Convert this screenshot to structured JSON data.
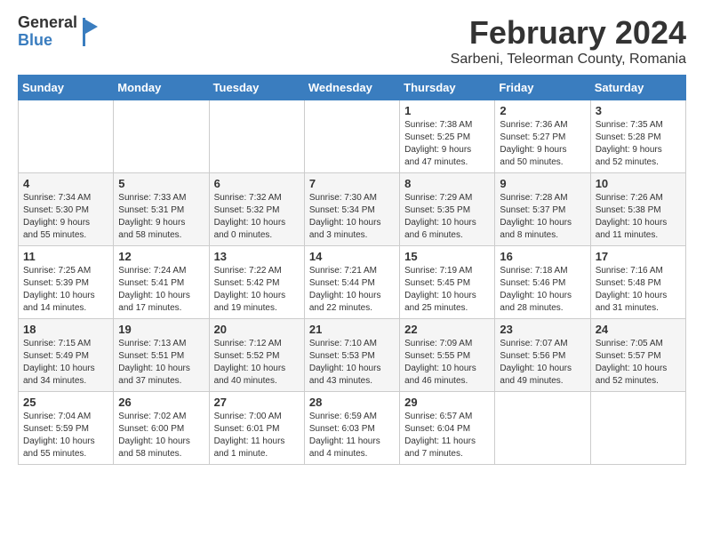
{
  "header": {
    "logo_general": "General",
    "logo_blue": "Blue",
    "month_title": "February 2024",
    "subtitle": "Sarbeni, Teleorman County, Romania"
  },
  "weekdays": [
    "Sunday",
    "Monday",
    "Tuesday",
    "Wednesday",
    "Thursday",
    "Friday",
    "Saturday"
  ],
  "weeks": [
    [
      {
        "day": "",
        "info": ""
      },
      {
        "day": "",
        "info": ""
      },
      {
        "day": "",
        "info": ""
      },
      {
        "day": "",
        "info": ""
      },
      {
        "day": "1",
        "info": "Sunrise: 7:38 AM\nSunset: 5:25 PM\nDaylight: 9 hours\nand 47 minutes."
      },
      {
        "day": "2",
        "info": "Sunrise: 7:36 AM\nSunset: 5:27 PM\nDaylight: 9 hours\nand 50 minutes."
      },
      {
        "day": "3",
        "info": "Sunrise: 7:35 AM\nSunset: 5:28 PM\nDaylight: 9 hours\nand 52 minutes."
      }
    ],
    [
      {
        "day": "4",
        "info": "Sunrise: 7:34 AM\nSunset: 5:30 PM\nDaylight: 9 hours\nand 55 minutes."
      },
      {
        "day": "5",
        "info": "Sunrise: 7:33 AM\nSunset: 5:31 PM\nDaylight: 9 hours\nand 58 minutes."
      },
      {
        "day": "6",
        "info": "Sunrise: 7:32 AM\nSunset: 5:32 PM\nDaylight: 10 hours\nand 0 minutes."
      },
      {
        "day": "7",
        "info": "Sunrise: 7:30 AM\nSunset: 5:34 PM\nDaylight: 10 hours\nand 3 minutes."
      },
      {
        "day": "8",
        "info": "Sunrise: 7:29 AM\nSunset: 5:35 PM\nDaylight: 10 hours\nand 6 minutes."
      },
      {
        "day": "9",
        "info": "Sunrise: 7:28 AM\nSunset: 5:37 PM\nDaylight: 10 hours\nand 8 minutes."
      },
      {
        "day": "10",
        "info": "Sunrise: 7:26 AM\nSunset: 5:38 PM\nDaylight: 10 hours\nand 11 minutes."
      }
    ],
    [
      {
        "day": "11",
        "info": "Sunrise: 7:25 AM\nSunset: 5:39 PM\nDaylight: 10 hours\nand 14 minutes."
      },
      {
        "day": "12",
        "info": "Sunrise: 7:24 AM\nSunset: 5:41 PM\nDaylight: 10 hours\nand 17 minutes."
      },
      {
        "day": "13",
        "info": "Sunrise: 7:22 AM\nSunset: 5:42 PM\nDaylight: 10 hours\nand 19 minutes."
      },
      {
        "day": "14",
        "info": "Sunrise: 7:21 AM\nSunset: 5:44 PM\nDaylight: 10 hours\nand 22 minutes."
      },
      {
        "day": "15",
        "info": "Sunrise: 7:19 AM\nSunset: 5:45 PM\nDaylight: 10 hours\nand 25 minutes."
      },
      {
        "day": "16",
        "info": "Sunrise: 7:18 AM\nSunset: 5:46 PM\nDaylight: 10 hours\nand 28 minutes."
      },
      {
        "day": "17",
        "info": "Sunrise: 7:16 AM\nSunset: 5:48 PM\nDaylight: 10 hours\nand 31 minutes."
      }
    ],
    [
      {
        "day": "18",
        "info": "Sunrise: 7:15 AM\nSunset: 5:49 PM\nDaylight: 10 hours\nand 34 minutes."
      },
      {
        "day": "19",
        "info": "Sunrise: 7:13 AM\nSunset: 5:51 PM\nDaylight: 10 hours\nand 37 minutes."
      },
      {
        "day": "20",
        "info": "Sunrise: 7:12 AM\nSunset: 5:52 PM\nDaylight: 10 hours\nand 40 minutes."
      },
      {
        "day": "21",
        "info": "Sunrise: 7:10 AM\nSunset: 5:53 PM\nDaylight: 10 hours\nand 43 minutes."
      },
      {
        "day": "22",
        "info": "Sunrise: 7:09 AM\nSunset: 5:55 PM\nDaylight: 10 hours\nand 46 minutes."
      },
      {
        "day": "23",
        "info": "Sunrise: 7:07 AM\nSunset: 5:56 PM\nDaylight: 10 hours\nand 49 minutes."
      },
      {
        "day": "24",
        "info": "Sunrise: 7:05 AM\nSunset: 5:57 PM\nDaylight: 10 hours\nand 52 minutes."
      }
    ],
    [
      {
        "day": "25",
        "info": "Sunrise: 7:04 AM\nSunset: 5:59 PM\nDaylight: 10 hours\nand 55 minutes."
      },
      {
        "day": "26",
        "info": "Sunrise: 7:02 AM\nSunset: 6:00 PM\nDaylight: 10 hours\nand 58 minutes."
      },
      {
        "day": "27",
        "info": "Sunrise: 7:00 AM\nSunset: 6:01 PM\nDaylight: 11 hours\nand 1 minute."
      },
      {
        "day": "28",
        "info": "Sunrise: 6:59 AM\nSunset: 6:03 PM\nDaylight: 11 hours\nand 4 minutes."
      },
      {
        "day": "29",
        "info": "Sunrise: 6:57 AM\nSunset: 6:04 PM\nDaylight: 11 hours\nand 7 minutes."
      },
      {
        "day": "",
        "info": ""
      },
      {
        "day": "",
        "info": ""
      }
    ]
  ]
}
